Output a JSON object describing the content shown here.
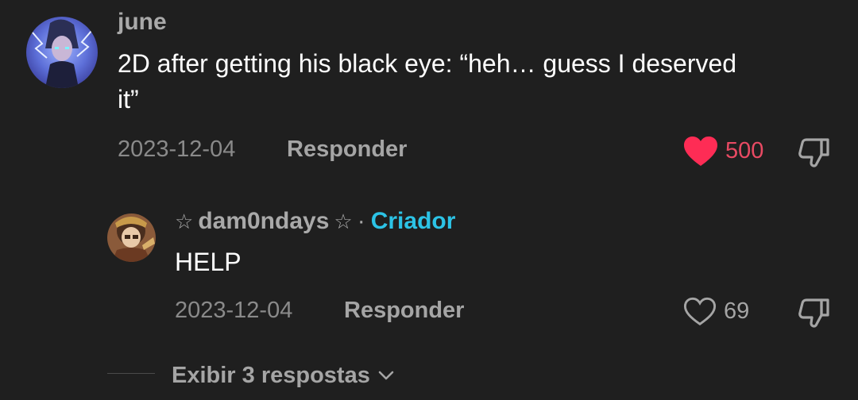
{
  "comment": {
    "username": "june",
    "text": "2D after getting his black eye: “heh… guess I deserved it”",
    "date": "2023-12-04",
    "reply_label": "Responder",
    "like_count": "500",
    "liked": true,
    "avatar_icon": "profile-avatar-icon"
  },
  "reply": {
    "star_left": "☆",
    "username": "dam0ndays",
    "star_right": "☆",
    "separator": "·",
    "badge": "Criador",
    "text": "HELP",
    "date": "2023-12-04",
    "reply_label": "Responder",
    "like_count": "69",
    "liked": false,
    "avatar_icon": "profile-avatar-icon"
  },
  "thread": {
    "view_replies_label": "Exibir 3 respostas",
    "chevron_icon": "chevron-down-icon"
  },
  "colors": {
    "background": "#1f1f1f",
    "liked_heart": "#fe2c55",
    "liked_count": "#e84a63",
    "creator_badge": "#2cc3e6",
    "muted_text": "#a5a5a5"
  }
}
